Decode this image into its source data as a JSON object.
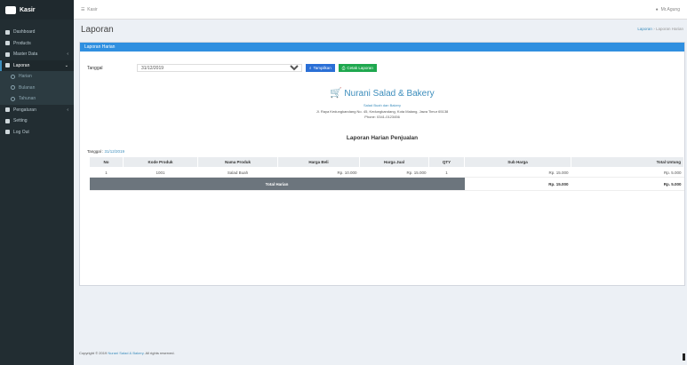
{
  "app": {
    "brand": "Kasir"
  },
  "sidebar": {
    "items": [
      {
        "label": "Dashboard",
        "icon": "dashboard-icon"
      },
      {
        "label": "Products",
        "icon": "cube-icon"
      },
      {
        "label": "Master Data",
        "icon": "database-icon"
      },
      {
        "label": "Laporan",
        "icon": "file-icon"
      },
      {
        "label": "Harian",
        "icon": "circle-icon"
      },
      {
        "label": "Bulanan",
        "icon": "circle-icon"
      },
      {
        "label": "Tahunan",
        "icon": "circle-icon"
      },
      {
        "label": "Pengaturan",
        "icon": "gear-icon"
      },
      {
        "label": "Setting",
        "icon": "wrench-icon"
      },
      {
        "label": "Log Out",
        "icon": "logout-icon"
      }
    ]
  },
  "topbar": {
    "left": "Kasir",
    "user": "Mr.Agung"
  },
  "content": {
    "title": "Laporan",
    "breadcrumb_home": "Laporan",
    "breadcrumb_current": "Laporan Harian"
  },
  "panel": {
    "header": "Laporan Harian"
  },
  "filter": {
    "label": "Tanggal",
    "value": "31/12/2019",
    "btn_search": "Tampilkan",
    "btn_print": "Cetak Laporan"
  },
  "shop": {
    "name": "Nurani Salad & Bakery",
    "subtitle": "Salad Buah dan Bakery",
    "address": "Jl. Raya Kedungkandang No. 45, Kedungkandang, Kota Malang, Jawa Timur 65138",
    "phone": "Phone: 0341-0123456"
  },
  "report": {
    "title": "Laporan Harian Penjualan",
    "period_label": "Tanggal :",
    "period_value": "31/12/2019"
  },
  "table": {
    "columns": [
      "No",
      "Kode Produk",
      "Nama Produk",
      "Harga Beli",
      "Harga Jual",
      "QTY",
      "Sub Harga",
      "Total Untung"
    ],
    "rows": [
      [
        "1",
        "1001",
        "Salad Buah",
        "Rp. 10.000",
        "Rp. 15.000",
        "1",
        "Rp. 15.000",
        "Rp. 5.000"
      ]
    ],
    "total_label": "Total Harian",
    "total_sub": "Rp. 15.000",
    "total_profit": "Rp. 5.000"
  },
  "footer": {
    "text": "Copyright © 2019",
    "link": "Nurani Salad & Bakery.",
    "rest": "All rights reserved."
  }
}
